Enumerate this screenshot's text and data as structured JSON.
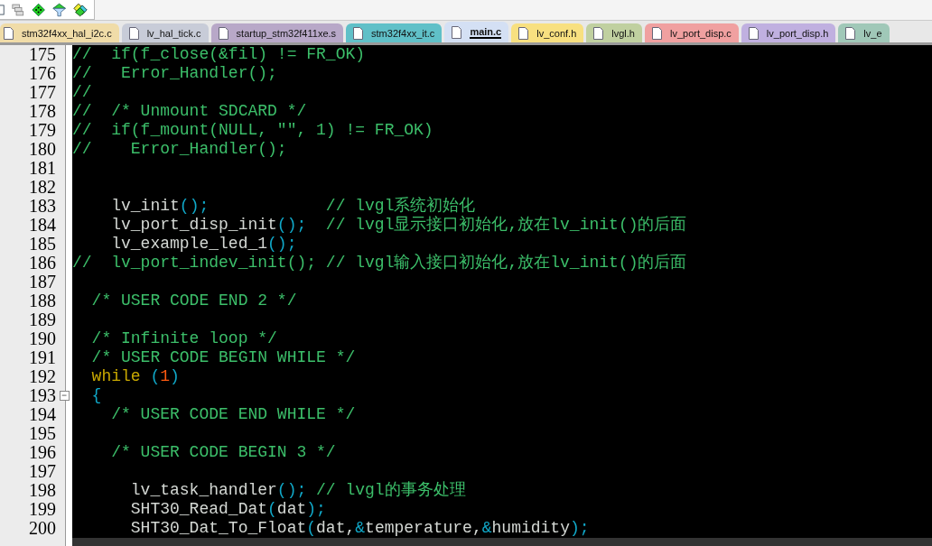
{
  "toolbar": {
    "buttons": [
      {
        "kind": "doc"
      },
      {
        "kind": "windows"
      },
      {
        "kind": "diamond"
      },
      {
        "kind": "filter"
      },
      {
        "kind": "multi"
      }
    ]
  },
  "tabs": [
    {
      "label": "stm32f4xx_hal_i2c.c",
      "color": "#f0dca8",
      "selected": false
    },
    {
      "label": "lv_hal_tick.c",
      "color": "#c8ccd8",
      "selected": false
    },
    {
      "label": "startup_stm32f411xe.s",
      "color": "#b8a8c8",
      "selected": false
    },
    {
      "label": "stm32f4xx_it.c",
      "color": "#60c0c8",
      "selected": false
    },
    {
      "label": "main.c",
      "color": "#d4e0f4",
      "selected": true
    },
    {
      "label": "lv_conf.h",
      "color": "#f8e080",
      "selected": false
    },
    {
      "label": "lvgl.h",
      "color": "#c0d0a0",
      "selected": false
    },
    {
      "label": "lv_port_disp.c",
      "color": "#f0a0a0",
      "selected": false
    },
    {
      "label": "lv_port_disp.h",
      "color": "#c0b0e0",
      "selected": false
    },
    {
      "label": "lv_e",
      "color": "#a0c8b8",
      "selected": false
    }
  ],
  "editor": {
    "lines": [
      {
        "number": "175",
        "tokens": [
          {
            "kind": "comment",
            "text": "//  if(f_close(&fil) != FR_OK)"
          }
        ]
      },
      {
        "number": "176",
        "tokens": [
          {
            "kind": "comment",
            "text": "//   Error_Handler();"
          }
        ]
      },
      {
        "number": "177",
        "tokens": [
          {
            "kind": "comment",
            "text": "//"
          }
        ]
      },
      {
        "number": "178",
        "tokens": [
          {
            "kind": "comment",
            "text": "//  /* Unmount SDCARD */"
          }
        ]
      },
      {
        "number": "179",
        "tokens": [
          {
            "kind": "comment",
            "text": "//  if(f_mount(NULL, \"\", 1) != FR_OK)"
          }
        ]
      },
      {
        "number": "180",
        "tokens": [
          {
            "kind": "comment",
            "text": "//    Error_Handler();"
          }
        ]
      },
      {
        "number": "181"
      },
      {
        "number": "182"
      },
      {
        "number": "183",
        "tokens": [
          {
            "kind": "plain",
            "text": "    lv_init"
          },
          {
            "kind": "paren",
            "text": "();"
          },
          {
            "kind": "comment",
            "text": "            // lvgl系统初始化"
          }
        ]
      },
      {
        "number": "184",
        "tokens": [
          {
            "kind": "plain",
            "text": "    lv_port_disp_init"
          },
          {
            "kind": "paren",
            "text": "();"
          },
          {
            "kind": "comment",
            "text": "  // lvgl显示接口初始化,放在lv_init()的后面"
          }
        ]
      },
      {
        "number": "185",
        "tokens": [
          {
            "kind": "plain",
            "text": "    lv_example_led_1"
          },
          {
            "kind": "paren",
            "text": "();"
          }
        ]
      },
      {
        "number": "186",
        "tokens": [
          {
            "kind": "comment",
            "text": "//  lv_port_indev_init(); // lvgl输入接口初始化,放在lv_init()的后面"
          }
        ]
      },
      {
        "number": "187"
      },
      {
        "number": "188",
        "tokens": [
          {
            "kind": "comment",
            "text": "  /* USER CODE END 2 */"
          }
        ]
      },
      {
        "number": "189"
      },
      {
        "number": "190",
        "tokens": [
          {
            "kind": "comment",
            "text": "  /* Infinite loop */"
          }
        ]
      },
      {
        "number": "191",
        "tokens": [
          {
            "kind": "comment",
            "text": "  /* USER CODE BEGIN WHILE */"
          }
        ]
      },
      {
        "number": "192",
        "tokens": [
          {
            "kind": "keyword",
            "text": "  while "
          },
          {
            "kind": "paren",
            "text": "("
          },
          {
            "kind": "number",
            "text": "1"
          },
          {
            "kind": "paren",
            "text": ")"
          }
        ]
      },
      {
        "number": "193",
        "expanded": true,
        "tokens": [
          {
            "kind": "paren",
            "text": "  {"
          }
        ]
      },
      {
        "number": "194",
        "tokens": [
          {
            "kind": "comment",
            "text": "    /* USER CODE END WHILE */"
          }
        ]
      },
      {
        "number": "195"
      },
      {
        "number": "196",
        "tokens": [
          {
            "kind": "comment",
            "text": "    /* USER CODE BEGIN 3 */"
          }
        ]
      },
      {
        "number": "197"
      },
      {
        "number": "198",
        "tokens": [
          {
            "kind": "plain",
            "text": "      lv_task_handler"
          },
          {
            "kind": "paren",
            "text": "();"
          },
          {
            "kind": "comment",
            "text": " // lvgl的事务处理"
          }
        ]
      },
      {
        "number": "199",
        "tokens": [
          {
            "kind": "plain",
            "text": "      SHT30_Read_Dat"
          },
          {
            "kind": "paren",
            "text": "("
          },
          {
            "kind": "plain",
            "text": "dat"
          },
          {
            "kind": "paren",
            "text": ");"
          }
        ]
      },
      {
        "number": "200",
        "tokens": [
          {
            "kind": "plain",
            "text": "      SHT30_Dat_To_Float"
          },
          {
            "kind": "paren",
            "text": "("
          },
          {
            "kind": "plain",
            "text": "dat,"
          },
          {
            "kind": "paren",
            "text": "&"
          },
          {
            "kind": "plain",
            "text": "temperature,"
          },
          {
            "kind": "paren",
            "text": "&"
          },
          {
            "kind": "plain",
            "text": "humidity"
          },
          {
            "kind": "paren",
            "text": ");"
          }
        ]
      }
    ]
  }
}
